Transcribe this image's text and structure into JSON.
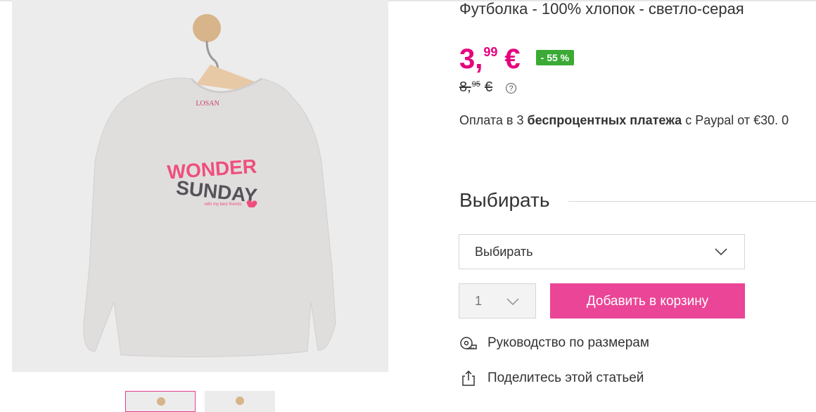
{
  "product": {
    "title": "Футболка - 100% хлопок - светло-серая",
    "image_alt": "product-photo",
    "shirt_print": {
      "line1": "WONDER",
      "line2": "SUNDAY",
      "tagline": "with my best friends",
      "brand_tag": "LOSAN"
    }
  },
  "price": {
    "integer": "3",
    "comma": ",",
    "decimal": "99",
    "currency": "€",
    "discount": "- 55 %",
    "old_integer": "8,",
    "old_decimal": "95",
    "old_currency": "€",
    "help": "?"
  },
  "payment": {
    "prefix": "Оплата в 3 ",
    "bold": "беспроцентных платежа",
    "suffix": " с Paypal от €30. 0"
  },
  "selection": {
    "heading": "Выбирать",
    "size_placeholder": "Выбирать",
    "quantity": "1",
    "add_to_cart": "Добавить в корзину"
  },
  "links": {
    "size_guide": "Руководство по размерам",
    "share": "Поделитесь этой статьей"
  },
  "colors": {
    "accent": "#e6007e",
    "button": "#ea4596",
    "discount": "#3aaa35"
  }
}
